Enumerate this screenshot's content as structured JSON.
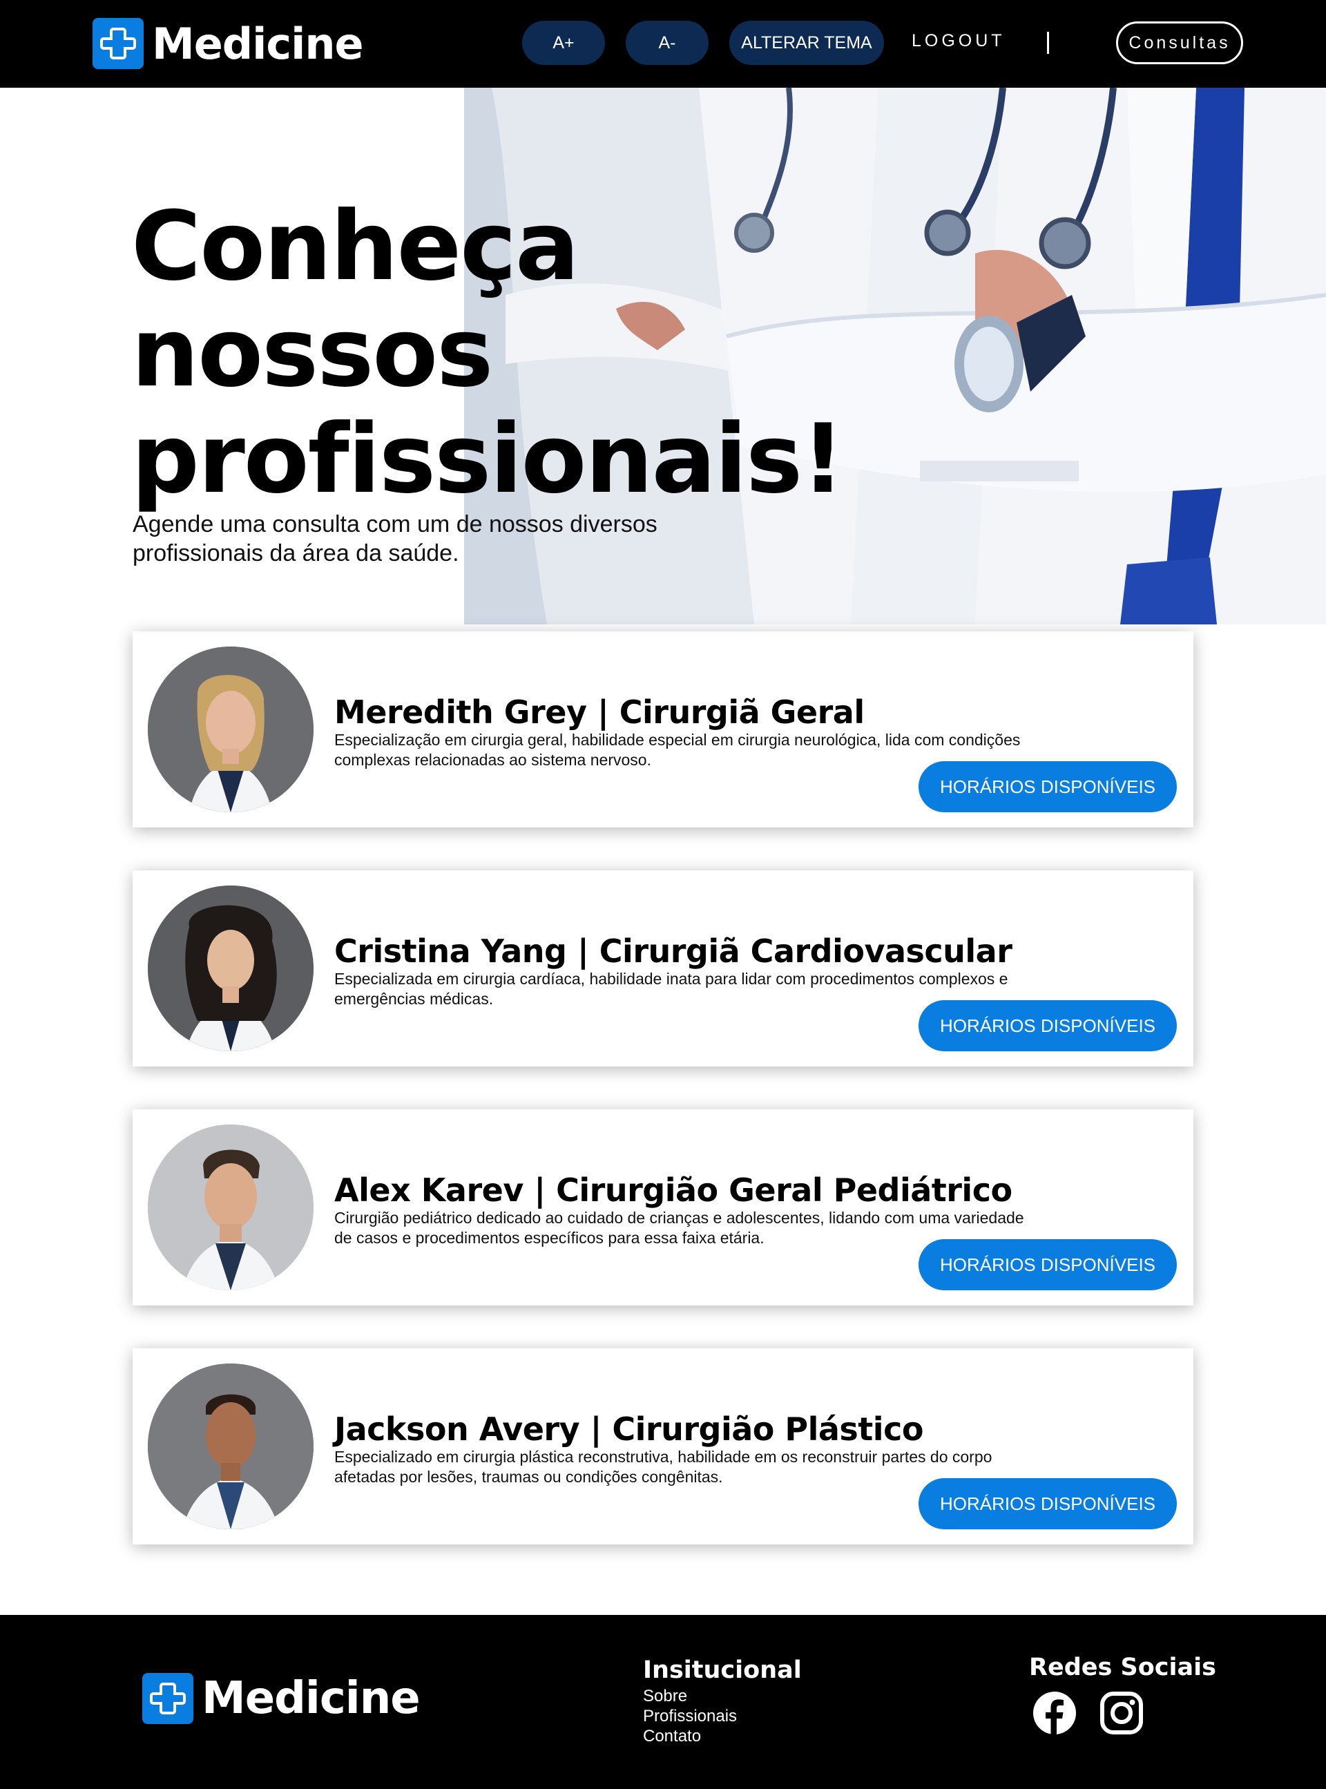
{
  "header": {
    "brand": "Medicine",
    "font_increase_label": "A+",
    "font_decrease_label": "A-",
    "theme_label": "ALTERAR TEMA",
    "logout_label": "LOGOUT",
    "consultas_label": "Consultas"
  },
  "hero": {
    "title_line1": "Conheça",
    "title_line2": "nossos",
    "title_line3": "profissionais!",
    "subtitle": "Agende uma consulta com um de nossos diversos profissionais da área da saúde."
  },
  "doctors": [
    {
      "title": "Meredith Grey | Cirurgiã Geral",
      "description": "Especialização em cirurgia geral, habilidade especial em cirurgia neurológica, lida com condições complexas relacionadas ao sistema nervoso.",
      "button": "HORÁRIOS DISPONÍVEIS"
    },
    {
      "title": "Cristina Yang | Cirurgiã Cardiovascular",
      "description": "Especializada em cirurgia cardíaca, habilidade inata para lidar com procedimentos complexos e emergências médicas.",
      "button": "HORÁRIOS DISPONÍVEIS"
    },
    {
      "title": "Alex Karev | Cirurgião Geral Pediátrico",
      "description": "Cirurgião pediátrico dedicado ao cuidado de crianças e adolescentes, lidando com uma variedade de casos e procedimentos específicos para essa faixa etária.",
      "button": "HORÁRIOS DISPONÍVEIS"
    },
    {
      "title": "Jackson Avery | Cirurgião Plástico",
      "description": "Especializado em cirurgia plástica reconstrutiva, habilidade em os reconstruir partes do corpo afetadas por lesões, traumas ou condições congênitas.",
      "button": "HORÁRIOS DISPONÍVEIS"
    }
  ],
  "footer": {
    "brand": "Medicine",
    "institutional_title": "Insitucional",
    "links": [
      "Sobre",
      "Profissionais",
      "Contato"
    ],
    "social_title": "Redes Sociais",
    "social_icons": [
      "facebook-icon",
      "instagram-icon"
    ]
  },
  "colors": {
    "accent": "#0a7de0",
    "dark_button": "#0c2a52",
    "bar_background": "#000000"
  }
}
